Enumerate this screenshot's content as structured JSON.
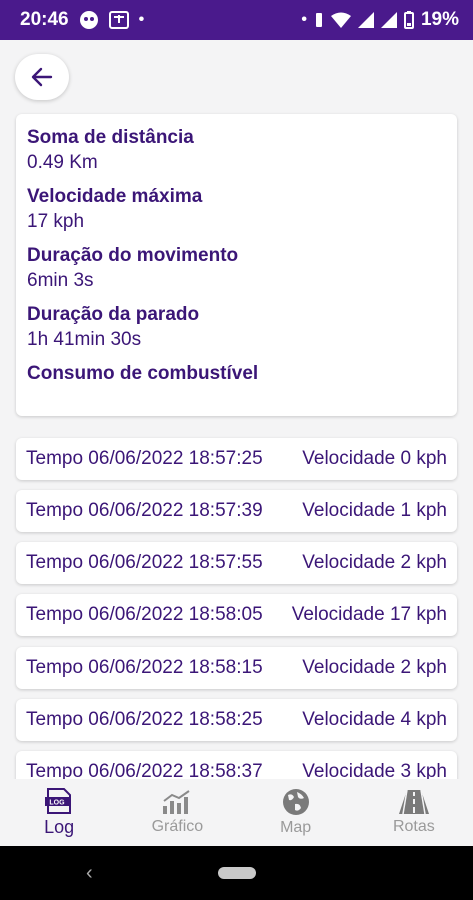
{
  "status_bar": {
    "time": "20:46",
    "battery": "19%",
    "left_icons": [
      "app-notification-icon",
      "translate-icon"
    ],
    "right_icons": [
      "vibrate-icon",
      "wifi-icon",
      "signal-icon",
      "signal-icon",
      "battery-icon"
    ]
  },
  "summary": {
    "items": [
      {
        "label": "Soma de distância",
        "value": "0.49 Km"
      },
      {
        "label": "Velocidade máxima",
        "value": "17 kph"
      },
      {
        "label": "Duração do movimento",
        "value": "6min 3s"
      },
      {
        "label": "Duração da parado",
        "value": "1h 41min 30s"
      },
      {
        "label": "Consumo de combustível",
        "value": ""
      }
    ]
  },
  "log_rows": [
    {
      "time": "Tempo 06/06/2022 18:57:25",
      "speed": "Velocidade 0 kph"
    },
    {
      "time": "Tempo 06/06/2022 18:57:39",
      "speed": "Velocidade 1 kph"
    },
    {
      "time": "Tempo 06/06/2022 18:57:55",
      "speed": "Velocidade 2 kph"
    },
    {
      "time": "Tempo 06/06/2022 18:58:05",
      "speed": "Velocidade 17 kph"
    },
    {
      "time": "Tempo 06/06/2022 18:58:15",
      "speed": "Velocidade 2 kph"
    },
    {
      "time": "Tempo 06/06/2022 18:58:25",
      "speed": "Velocidade 4 kph"
    },
    {
      "time": "Tempo 06/06/2022 18:58:37",
      "speed": "Velocidade 3 kph"
    }
  ],
  "bottom_nav": [
    {
      "label": "Log",
      "icon": "log-icon",
      "active": true
    },
    {
      "label": "Gráfico",
      "icon": "chart-icon",
      "active": false
    },
    {
      "label": "Map",
      "icon": "globe-icon",
      "active": false
    },
    {
      "label": "Rotas",
      "icon": "road-icon",
      "active": false
    }
  ],
  "colors": {
    "status_bar": "#4a1a8c",
    "accent": "#3b1677",
    "inactive": "#9a9a9a"
  }
}
